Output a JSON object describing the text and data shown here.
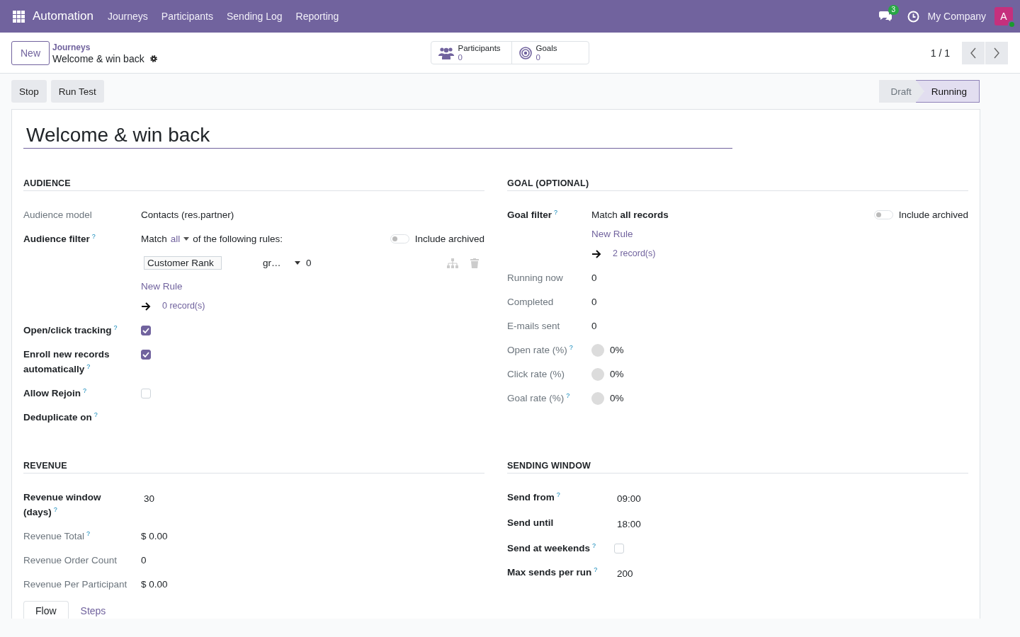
{
  "navbar": {
    "app_name": "Automation",
    "menu": [
      "Journeys",
      "Participants",
      "Sending Log",
      "Reporting"
    ],
    "messages_badge": "3",
    "company": "My Company",
    "avatar_letter": "A"
  },
  "control_panel": {
    "new_button": "New",
    "breadcrumb": "Journeys",
    "record_title": "Welcome & win back",
    "stat_buttons": [
      {
        "kind": "people",
        "label": "Participants",
        "value": "0"
      },
      {
        "kind": "target",
        "label": "Goals",
        "value": "0"
      }
    ],
    "pager": "1 / 1"
  },
  "actions": [
    "Stop",
    "Run Test"
  ],
  "statusbar": [
    {
      "label": "Draft",
      "selected": false
    },
    {
      "label": "Running",
      "selected": true
    }
  ],
  "form": {
    "title": "Welcome & win back",
    "sections": [
      {
        "title": "AUDIENCE",
        "fields": [
          {
            "kind": "text",
            "label": "Audience model",
            "readonly": true,
            "value": "Contacts (res.partner)"
          },
          {
            "kind": "domain",
            "label": "Audience filter",
            "help": "?",
            "readonly": false,
            "match_prefix": "Match",
            "match_selector": "all",
            "match_suffix": "of the following rules:",
            "include_archived": {
              "label": "Include archived",
              "on": false
            },
            "rules": [
              {
                "field": "Customer Rank",
                "operator": "gr…",
                "value": "0"
              }
            ],
            "new_rule": "New Rule",
            "records": "0 record(s)"
          },
          {
            "kind": "checkbox",
            "label": "Open/click tracking",
            "help": "?",
            "readonly": false,
            "checked": true
          },
          {
            "kind": "checkbox",
            "label": "Enroll new records automatically",
            "help": "?",
            "readonly": false,
            "checked": true
          },
          {
            "kind": "checkbox",
            "label": "Allow Rejoin",
            "help": "?",
            "readonly": false,
            "checked": false
          },
          {
            "kind": "text",
            "label": "Deduplicate on",
            "help": "?",
            "readonly": false
          }
        ]
      },
      {
        "title": "GOAL (OPTIONAL)",
        "fields": [
          {
            "kind": "domain",
            "label": "Goal filter",
            "help": "?",
            "readonly": false,
            "match_text": "Match **all records**",
            "include_archived": {
              "label": "Include archived",
              "on": false
            },
            "new_rule": "New Rule",
            "records": "2 record(s)"
          },
          {
            "kind": "text",
            "label": "Running now",
            "readonly": true,
            "value": "0"
          },
          {
            "kind": "text",
            "label": "Completed",
            "readonly": true,
            "value": "0"
          },
          {
            "kind": "text",
            "label": "E-mails sent",
            "readonly": true,
            "value": "0"
          },
          {
            "kind": "progress",
            "label": "Open rate (%)",
            "help": "?",
            "readonly": true,
            "level": 0,
            "value": "0%"
          },
          {
            "kind": "progress",
            "label": "Click rate (%)",
            "readonly": true,
            "level": 0,
            "value": "0%"
          },
          {
            "kind": "progress",
            "label": "Goal rate (%)",
            "help": "?",
            "readonly": true,
            "level": 0,
            "value": "0%"
          }
        ]
      },
      {
        "title": "REVENUE",
        "fields": [
          {
            "kind": "input",
            "label": "Revenue window (days)",
            "help": "?",
            "readonly": false,
            "value": "30"
          },
          {
            "kind": "text",
            "label": "Revenue Total",
            "help": "?",
            "readonly": true,
            "value": "$ 0.00"
          },
          {
            "kind": "text",
            "label": "Revenue Order Count",
            "readonly": true,
            "value": "0"
          },
          {
            "kind": "text",
            "label": "Revenue Per Participant",
            "readonly": true,
            "value": "$ 0.00"
          }
        ]
      },
      {
        "title": "SENDING WINDOW",
        "fields": [
          {
            "kind": "input",
            "label": "Send from",
            "help": "?",
            "readonly": false,
            "value": "09:00"
          },
          {
            "kind": "input",
            "label": "Send until",
            "readonly": false,
            "value": "18:00"
          },
          {
            "kind": "checkbox",
            "label": "Send at weekends",
            "help": "?",
            "readonly": false,
            "checked": false
          },
          {
            "kind": "input",
            "label": "Max sends per run",
            "help": "?",
            "readonly": false,
            "value": "200"
          }
        ]
      }
    ],
    "notebook_tabs": [
      {
        "label": "Flow",
        "selected": true
      },
      {
        "label": "Steps",
        "selected": false
      }
    ]
  }
}
